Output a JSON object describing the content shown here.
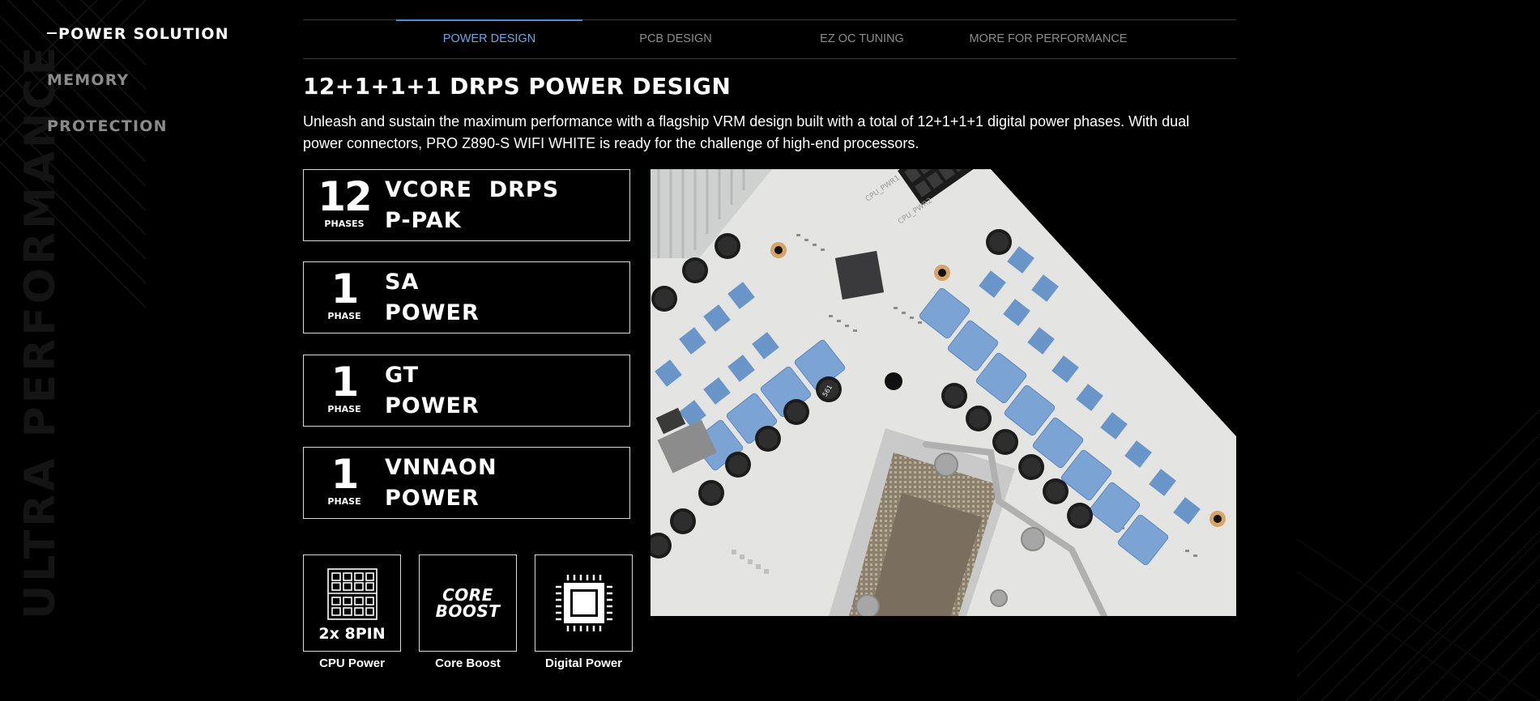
{
  "side_nav": {
    "items": [
      {
        "label": "POWER SOLUTION",
        "active": true
      },
      {
        "label": "MEMORY",
        "active": false
      },
      {
        "label": "PROTECTION",
        "active": false
      }
    ],
    "background_watermark": "ULTRA PERFORMANCE"
  },
  "tabs": [
    {
      "label": "POWER DESIGN",
      "active": true
    },
    {
      "label": "PCB DESIGN",
      "active": false
    },
    {
      "label": "EZ OC TUNING",
      "active": false
    },
    {
      "label": "MORE FOR PERFORMANCE",
      "active": false
    }
  ],
  "section": {
    "title": "12+1+1+1 DRPS POWER DESIGN",
    "description": "Unleash and sustain the maximum performance with a flagship VRM design built with a total of 12+1+1+1 digital power phases. With dual power connectors, PRO Z890-S WIFI WHITE is ready for the challenge of high-end processors."
  },
  "phase_cards": [
    {
      "number": "12",
      "unit": "PHASES",
      "label": "VCORE  DRPS\nP-PAK"
    },
    {
      "number": "1",
      "unit": "PHASE",
      "label": "SA\nPOWER"
    },
    {
      "number": "1",
      "unit": "PHASE",
      "label": "GT\nPOWER"
    },
    {
      "number": "1",
      "unit": "PHASE",
      "label": "VNNAON\nPOWER"
    }
  ],
  "features": [
    {
      "icon": "connector-8pin-icon",
      "icon_text": "2x 8PIN",
      "caption": "CPU Power"
    },
    {
      "icon": "core-boost-icon",
      "icon_text_line1": "CORE",
      "icon_text_line2": "BOOST",
      "caption": "Core Boost"
    },
    {
      "icon": "chip-icon",
      "caption": "Digital Power"
    }
  ],
  "board_image": {
    "silkscreen": [
      "CPU_PWR1",
      "CPU_PWR2"
    ],
    "capacitor_label": "561"
  },
  "colors": {
    "accent": "#4a90d9",
    "choke_blue": "#7ba3d4",
    "border": "#d8d8d8",
    "inactive_text": "#8a8a8a"
  }
}
